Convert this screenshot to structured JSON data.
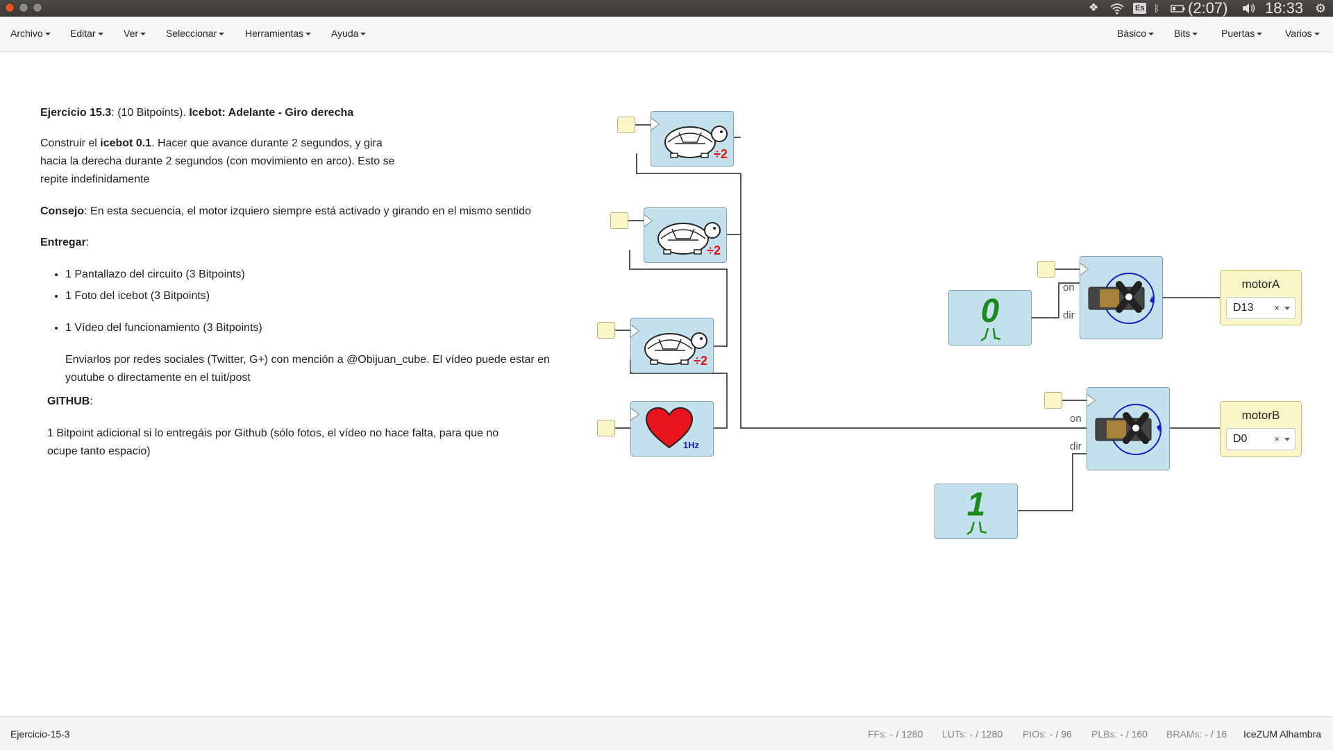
{
  "system_tray": {
    "language": "Es",
    "battery_time": "(2:07)",
    "clock": "18:33"
  },
  "menu_left": [
    "Archivo",
    "Editar",
    "Ver",
    "Seleccionar",
    "Herramientas",
    "Ayuda"
  ],
  "menu_right": [
    "Básico",
    "Bits",
    "Puertas",
    "Varios"
  ],
  "notes": {
    "title_bold": "Ejercicio 15.3",
    "title_mid": ": (10 Bitpoints). ",
    "title_bold2": "Icebot: Adelante - Giro derecha",
    "p1_a": "Construir el ",
    "p1_bold": "icebot 0.1",
    "p1_b": ". Hacer que avance durante 2 segundos, y gira",
    "p1_c": "hacia la derecha durante 2 segundos (con movimiento en arco). Esto se",
    "p1_d": "repite indefinidamente",
    "tip_bold": "Consejo",
    "tip_text": ": En esta secuencia, el motor izquiero siempre está activado y girando en el mismo sentido",
    "deliver_bold": "Entregar",
    "deliver_colon": ":",
    "items": [
      "1 Pantallazo del circuito (3 Bitpoints)",
      "1 Foto del icebot (3 Bitpoints)",
      "1 Vídeo del funcionamiento (3 Bitpoints)"
    ],
    "send_a": "Enviarlos por redes sociales (Twitter, G+) con mención a @Obijuan_cube. El vídeo puede estar en",
    "send_b": "youtube o directamente en el tuit/post",
    "github_bold": "GITHUB",
    "github_colon": ":",
    "github_a": "1 Bitpoint adicional si lo entregáis por Github (sólo fotos, el vídeo no hace falta, para que no",
    "github_b": "ocupe tanto espacio)"
  },
  "blocks": {
    "divider_label": "÷2",
    "heart_label": "1Hz",
    "const_a": "0",
    "const_b": "1",
    "port_on": "on",
    "port_dir": "dir"
  },
  "outputs": [
    {
      "name": "motorA",
      "pin": "D13"
    },
    {
      "name": "motorB",
      "pin": "D0"
    }
  ],
  "select_clear": "×",
  "status": {
    "project": "Ejercicio-15-3",
    "ffs_label": "FFs:",
    "ffs_value": "- / 1280",
    "luts_label": "LUTs:",
    "luts_value": "- / 1280",
    "pios_label": "PIOs:",
    "pios_value": "- / 96",
    "plbs_label": "PLBs:",
    "plbs_value": "- / 160",
    "brams_label": "BRAMs:",
    "brams_value": "- / 16",
    "board": "IceZUM Alhambra"
  },
  "colors": {
    "block_fill": "#c4e0ec",
    "pin_fill": "#fbf6c8",
    "wire": "#555555",
    "heart": "#e8141c",
    "digit": "#1a8a1a",
    "divider_text": "#e01010",
    "hz_text": "#1020c0"
  }
}
